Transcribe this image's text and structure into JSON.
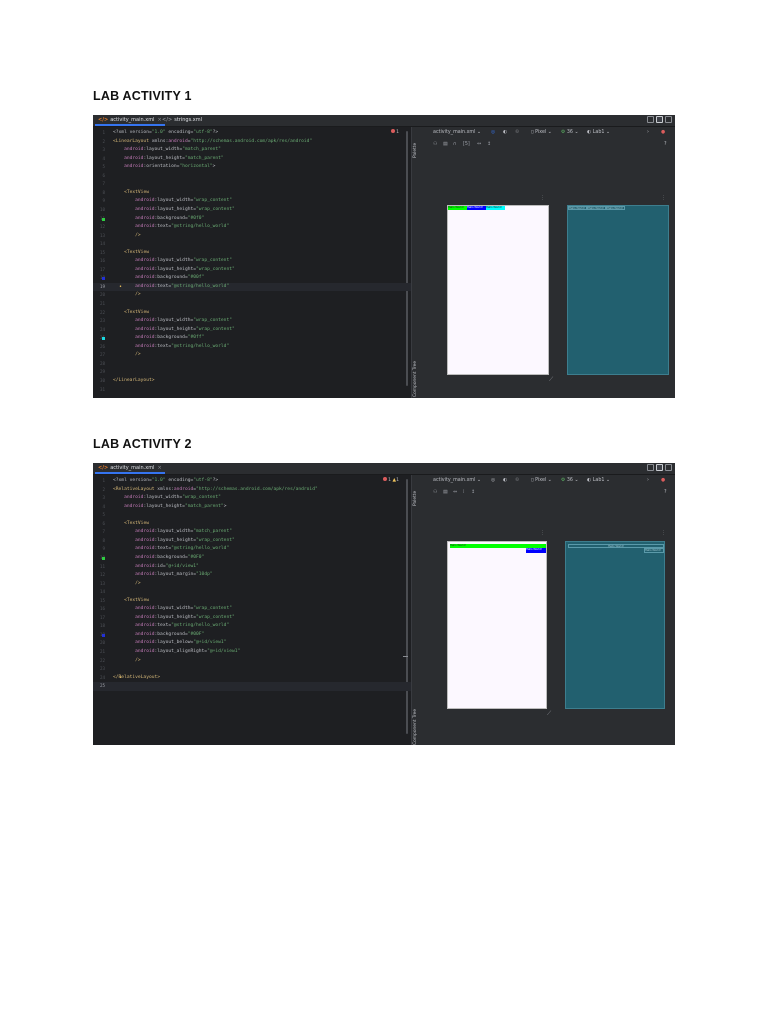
{
  "lab1": {
    "heading": "LAB ACTIVITY 1",
    "tabs": [
      {
        "label": "activity_main.xml",
        "active": true
      },
      {
        "label": "strings.xml",
        "active": false
      }
    ],
    "error_count": "1",
    "code_lines": [
      {
        "n": "1",
        "tokens": [
          [
            "plain",
            "<?xml version="
          ],
          [
            "str",
            "\"1.0\""
          ],
          [
            "plain",
            " encoding="
          ],
          [
            "str",
            "\"utf-8\""
          ],
          [
            "plain",
            "?>"
          ]
        ]
      },
      {
        "n": "2",
        "tokens": [
          [
            "tag",
            "<LinearLayout"
          ],
          [
            "plain",
            " xmlns:"
          ],
          [
            "attr",
            "android"
          ],
          [
            "plain",
            "="
          ],
          [
            "str",
            "\"http://schemas.android.com/apk/res/android\""
          ]
        ]
      },
      {
        "n": "3",
        "tokens": [
          [
            "plain",
            "    "
          ],
          [
            "attr",
            "android"
          ],
          [
            "plain",
            ":layout_width="
          ],
          [
            "str",
            "\"match_parent\""
          ]
        ]
      },
      {
        "n": "4",
        "tokens": [
          [
            "plain",
            "    "
          ],
          [
            "attr",
            "android"
          ],
          [
            "plain",
            ":layout_height="
          ],
          [
            "str",
            "\"match_parent\""
          ]
        ]
      },
      {
        "n": "5",
        "tokens": [
          [
            "plain",
            "    "
          ],
          [
            "attr",
            "android"
          ],
          [
            "plain",
            ":orientation="
          ],
          [
            "str",
            "\"horizontal\""
          ],
          [
            "plain",
            ">"
          ]
        ]
      },
      {
        "n": "6",
        "tokens": []
      },
      {
        "n": "7",
        "tokens": []
      },
      {
        "n": "8",
        "tokens": [
          [
            "plain",
            "    "
          ],
          [
            "tag",
            "<TextView"
          ]
        ]
      },
      {
        "n": "9",
        "tokens": [
          [
            "plain",
            "        "
          ],
          [
            "attr",
            "android"
          ],
          [
            "plain",
            ":layout_width="
          ],
          [
            "str",
            "\"wrap_content\""
          ]
        ]
      },
      {
        "n": "10",
        "tokens": [
          [
            "plain",
            "        "
          ],
          [
            "attr",
            "android"
          ],
          [
            "plain",
            ":layout_height="
          ],
          [
            "str",
            "\"wrap_content\""
          ]
        ]
      },
      {
        "n": "11",
        "tokens": [
          [
            "plain",
            "        "
          ],
          [
            "attr",
            "android"
          ],
          [
            "plain",
            ":background="
          ],
          [
            "str",
            "\"#0f0\""
          ]
        ],
        "mark": "#2ecc40"
      },
      {
        "n": "12",
        "tokens": [
          [
            "plain",
            "        "
          ],
          [
            "attr",
            "android"
          ],
          [
            "plain",
            ":text="
          ],
          [
            "str",
            "\"@string/hello_world\""
          ]
        ]
      },
      {
        "n": "13",
        "tokens": [
          [
            "plain",
            "        "
          ],
          [
            "tag",
            "/>"
          ]
        ]
      },
      {
        "n": "14",
        "tokens": []
      },
      {
        "n": "15",
        "tokens": [
          [
            "plain",
            "    "
          ],
          [
            "tag",
            "<TextView"
          ]
        ]
      },
      {
        "n": "16",
        "tokens": [
          [
            "plain",
            "        "
          ],
          [
            "attr",
            "android"
          ],
          [
            "plain",
            ":layout_width="
          ],
          [
            "str",
            "\"wrap_content\""
          ]
        ]
      },
      {
        "n": "17",
        "tokens": [
          [
            "plain",
            "        "
          ],
          [
            "attr",
            "android"
          ],
          [
            "plain",
            ":layout_height="
          ],
          [
            "str",
            "\"wrap_content\""
          ]
        ]
      },
      {
        "n": "18",
        "tokens": [
          [
            "plain",
            "        "
          ],
          [
            "attr",
            "android"
          ],
          [
            "plain",
            ":background="
          ],
          [
            "str",
            "\"#00f\""
          ]
        ],
        "mark": "#2230d8"
      },
      {
        "n": "19",
        "tokens": [
          [
            "plain",
            "        "
          ],
          [
            "attr",
            "android"
          ],
          [
            "plain",
            ":text="
          ],
          [
            "str",
            "\"@string/hello_world\""
          ]
        ],
        "current": true,
        "bulb": true
      },
      {
        "n": "20",
        "tokens": [
          [
            "plain",
            "        "
          ],
          [
            "tag",
            "/>"
          ]
        ]
      },
      {
        "n": "21",
        "tokens": []
      },
      {
        "n": "22",
        "tokens": [
          [
            "plain",
            "    "
          ],
          [
            "tag",
            "<TextView"
          ]
        ]
      },
      {
        "n": "23",
        "tokens": [
          [
            "plain",
            "        "
          ],
          [
            "attr",
            "android"
          ],
          [
            "plain",
            ":layout_width="
          ],
          [
            "str",
            "\"wrap_content\""
          ]
        ]
      },
      {
        "n": "24",
        "tokens": [
          [
            "plain",
            "        "
          ],
          [
            "attr",
            "android"
          ],
          [
            "plain",
            ":layout_height="
          ],
          [
            "str",
            "\"wrap_content\""
          ]
        ]
      },
      {
        "n": "25",
        "tokens": [
          [
            "plain",
            "        "
          ],
          [
            "attr",
            "android"
          ],
          [
            "plain",
            ":background="
          ],
          [
            "str",
            "\"#0ff\""
          ]
        ],
        "mark": "#18d8e0"
      },
      {
        "n": "26",
        "tokens": [
          [
            "plain",
            "        "
          ],
          [
            "attr",
            "android"
          ],
          [
            "plain",
            ":text="
          ],
          [
            "str",
            "\"@string/hello_world\""
          ]
        ]
      },
      {
        "n": "27",
        "tokens": [
          [
            "plain",
            "        "
          ],
          [
            "tag",
            "/>"
          ]
        ]
      },
      {
        "n": "28",
        "tokens": []
      },
      {
        "n": "29",
        "tokens": []
      },
      {
        "n": "30",
        "tokens": [
          [
            "tag",
            "</LinearLayout>"
          ]
        ]
      },
      {
        "n": "31",
        "tokens": []
      }
    ],
    "design_toolbar": {
      "file": "activity_main.xml",
      "device": "Pixel",
      "api": "36",
      "theme": "Lab1",
      "help": "?"
    },
    "side_labels": {
      "palette": "Palette",
      "component_tree": "Component Tree"
    }
  },
  "lab2": {
    "heading": "LAB ACTIVITY 2",
    "tabs": [
      {
        "label": "activity_main.xml",
        "active": true
      }
    ],
    "error_count": "1",
    "warning_count": "1",
    "code_lines": [
      {
        "n": "1",
        "tokens": [
          [
            "plain",
            "<?xml version="
          ],
          [
            "str",
            "\"1.0\""
          ],
          [
            "plain",
            " encoding="
          ],
          [
            "str",
            "\"utf-8\""
          ],
          [
            "plain",
            "?>"
          ]
        ]
      },
      {
        "n": "2",
        "tokens": [
          [
            "tag",
            "<RelativeLayout"
          ],
          [
            "plain",
            " xmlns:"
          ],
          [
            "attr",
            "android"
          ],
          [
            "plain",
            "="
          ],
          [
            "str",
            "\"http://schemas.android.com/apk/res/android\""
          ]
        ]
      },
      {
        "n": "3",
        "tokens": [
          [
            "plain",
            "    "
          ],
          [
            "attr",
            "android"
          ],
          [
            "plain",
            ":layout_width="
          ],
          [
            "str",
            "\"wrap_content\""
          ]
        ]
      },
      {
        "n": "4",
        "tokens": [
          [
            "plain",
            "    "
          ],
          [
            "attr",
            "android"
          ],
          [
            "plain",
            ":layout_height="
          ],
          [
            "str",
            "\"match_parent\""
          ],
          [
            "plain",
            ">"
          ]
        ]
      },
      {
        "n": "5",
        "tokens": []
      },
      {
        "n": "6",
        "tokens": [
          [
            "plain",
            "    "
          ],
          [
            "tag",
            "<TextView"
          ]
        ]
      },
      {
        "n": "7",
        "tokens": [
          [
            "plain",
            "        "
          ],
          [
            "attr",
            "android"
          ],
          [
            "plain",
            ":layout_width="
          ],
          [
            "str",
            "\"match_parent\""
          ]
        ]
      },
      {
        "n": "8",
        "tokens": [
          [
            "plain",
            "        "
          ],
          [
            "attr",
            "android"
          ],
          [
            "plain",
            ":layout_height="
          ],
          [
            "str",
            "\"wrap_content\""
          ]
        ]
      },
      {
        "n": "9",
        "tokens": [
          [
            "plain",
            "        "
          ],
          [
            "attr",
            "android"
          ],
          [
            "plain",
            ":text="
          ],
          [
            "str",
            "\"@string/hello_world\""
          ]
        ]
      },
      {
        "n": "10",
        "tokens": [
          [
            "plain",
            "        "
          ],
          [
            "attr",
            "android"
          ],
          [
            "plain",
            ":background="
          ],
          [
            "str",
            "\"#0F0\""
          ]
        ],
        "mark": "#2ecc40"
      },
      {
        "n": "11",
        "tokens": [
          [
            "plain",
            "        "
          ],
          [
            "attr",
            "android"
          ],
          [
            "plain",
            ":id="
          ],
          [
            "str",
            "\"@+id/view1\""
          ]
        ]
      },
      {
        "n": "12",
        "tokens": [
          [
            "plain",
            "        "
          ],
          [
            "attr",
            "android"
          ],
          [
            "plain",
            ":layout_margin="
          ],
          [
            "str",
            "\"10dp\""
          ]
        ]
      },
      {
        "n": "13",
        "tokens": [
          [
            "plain",
            "        "
          ],
          [
            "tag",
            "/>"
          ]
        ]
      },
      {
        "n": "14",
        "tokens": []
      },
      {
        "n": "15",
        "tokens": [
          [
            "plain",
            "    "
          ],
          [
            "tag",
            "<TextView"
          ]
        ]
      },
      {
        "n": "16",
        "tokens": [
          [
            "plain",
            "        "
          ],
          [
            "attr",
            "android"
          ],
          [
            "plain",
            ":layout_width="
          ],
          [
            "str",
            "\"wrap_content\""
          ]
        ]
      },
      {
        "n": "17",
        "tokens": [
          [
            "plain",
            "        "
          ],
          [
            "attr",
            "android"
          ],
          [
            "plain",
            ":layout_height="
          ],
          [
            "str",
            "\"wrap_content\""
          ]
        ]
      },
      {
        "n": "18",
        "tokens": [
          [
            "plain",
            "        "
          ],
          [
            "attr",
            "android"
          ],
          [
            "plain",
            ":text="
          ],
          [
            "str",
            "\"@string/hello_world\""
          ]
        ]
      },
      {
        "n": "19",
        "tokens": [
          [
            "plain",
            "        "
          ],
          [
            "attr",
            "android"
          ],
          [
            "plain",
            ":background="
          ],
          [
            "str",
            "\"#00F\""
          ]
        ],
        "mark": "#2230d8"
      },
      {
        "n": "20",
        "tokens": [
          [
            "plain",
            "        "
          ],
          [
            "attr",
            "android"
          ],
          [
            "plain",
            ":layout_below="
          ],
          [
            "str",
            "\"@+id/view1\""
          ]
        ]
      },
      {
        "n": "21",
        "tokens": [
          [
            "plain",
            "        "
          ],
          [
            "attr",
            "android"
          ],
          [
            "plain",
            ":layout_alignRight="
          ],
          [
            "str",
            "\"@+id/view1\""
          ]
        ]
      },
      {
        "n": "22",
        "tokens": [
          [
            "plain",
            "        "
          ],
          [
            "tag",
            "/>"
          ]
        ]
      },
      {
        "n": "23",
        "tokens": []
      },
      {
        "n": "24",
        "tokens": [
          [
            "tag",
            "</RelativeLayout>"
          ]
        ],
        "bulb": true
      },
      {
        "n": "25",
        "tokens": [],
        "current": true
      }
    ],
    "design_toolbar": {
      "file": "activity_main.xml",
      "device": "Pixel",
      "api": "36",
      "theme": "Lab1",
      "help": "?"
    },
    "side_labels": {
      "palette": "Palette",
      "component_tree": "Component Tree"
    }
  }
}
